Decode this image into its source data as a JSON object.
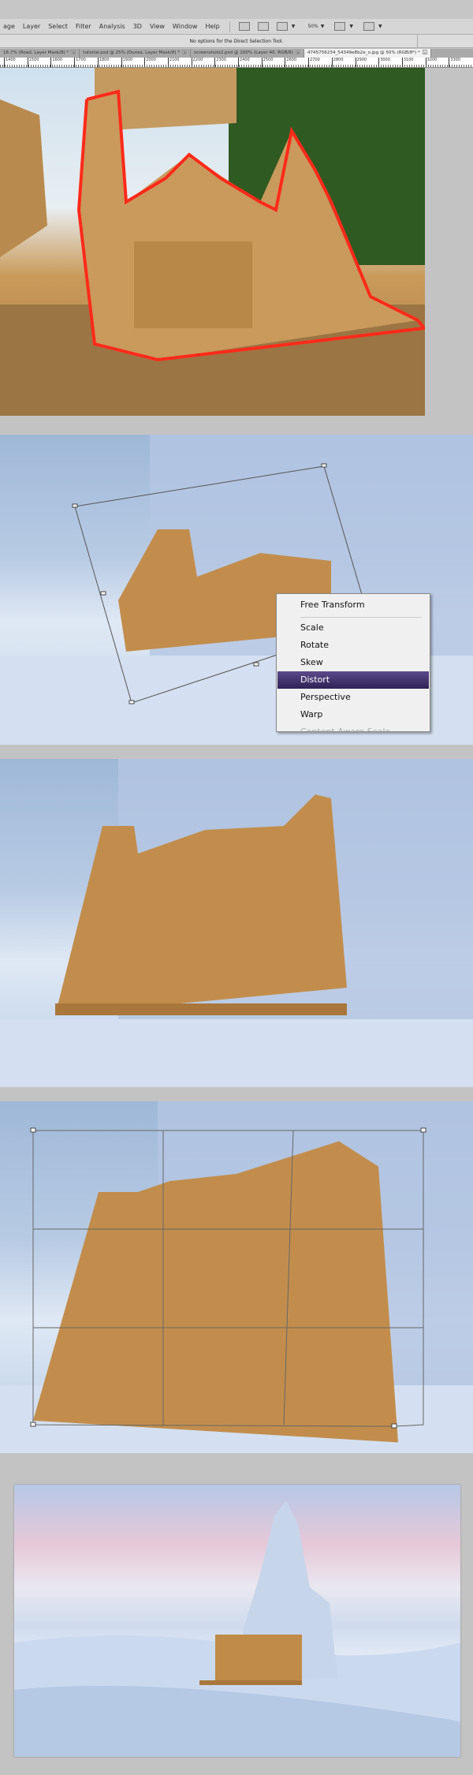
{
  "menubar": {
    "items": [
      "age",
      "Layer",
      "Select",
      "Filter",
      "Analysis",
      "3D",
      "View",
      "Window",
      "Help"
    ],
    "zoom": "50%"
  },
  "options_bar": {
    "text": "No options for the Direct Selection Tool."
  },
  "tabs": [
    {
      "label": "16.7% (Road, Layer Mask/8) *",
      "active": false
    },
    {
      "label": "tutorial.psd @ 25% (Dunes, Layer Mask/8) *",
      "active": false
    },
    {
      "label": "screenshots2.psd @ 100% (Layer 40, RGB/8)",
      "active": false
    },
    {
      "label": "4745756234_54349e8b2e_o.jpg @ 50% (RGB/8*) *",
      "active": true
    }
  ],
  "ruler": {
    "labels": [
      "1400",
      "1500",
      "1600",
      "1700",
      "1800",
      "1900",
      "2000",
      "2100",
      "2200",
      "2300",
      "2400",
      "2500",
      "2600",
      "2700",
      "2800",
      "2900",
      "3000",
      "3100",
      "3200",
      "3300"
    ]
  },
  "context_menu": {
    "items": [
      "Free Transform",
      "Scale",
      "Rotate",
      "Skew",
      "Distort",
      "Perspective",
      "Warp",
      "Content Aware Scale"
    ],
    "highlighted": "Distort",
    "highlight_color": "#3d2f6b"
  },
  "colors": {
    "selection": "#ff2a1a",
    "sand": "#c08a48",
    "snow": "#c9d8ee"
  }
}
